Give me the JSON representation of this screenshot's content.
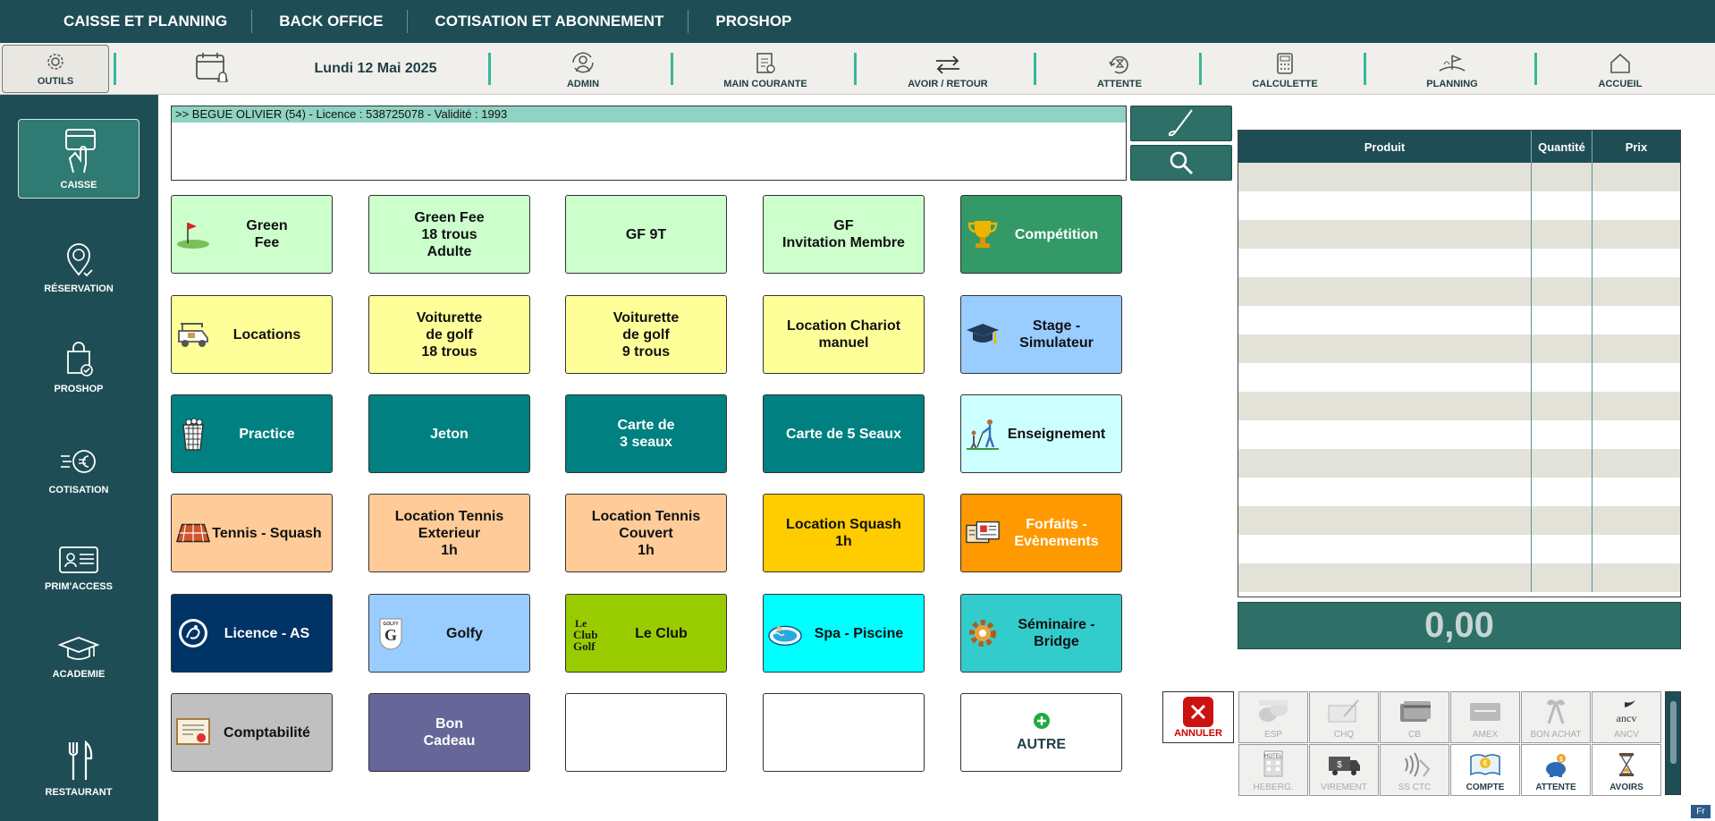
{
  "top_menu": [
    "CAISSE ET PLANNING",
    "BACK OFFICE",
    "COTISATION ET ABONNEMENT",
    "PROSHOP"
  ],
  "toolbar": {
    "outils": "OUTILS",
    "date": "Lundi 12 Mai 2025",
    "admin": "ADMIN",
    "main_courante": "MAIN COURANTE",
    "avoir_retour": "AVOIR / RETOUR",
    "attente": "ATTENTE",
    "calculette": "CALCULETTE",
    "planning": "PLANNING",
    "accueil": "ACCUEIL"
  },
  "sidebar": [
    "CAISSE",
    "RÉSERVATION",
    "PROSHOP",
    "COTISATION",
    "PRIM'ACCESS",
    "ACADEMIE",
    "RESTAURANT"
  ],
  "customer": {
    "line": ">> BEGUE OLIVIER (54) - Licence : 538725078 - Validité : 1993"
  },
  "products": [
    {
      "label": "Green\nFee",
      "bg": "#ccffcc",
      "fg": "#111111",
      "icon": "golf-flag-icon"
    },
    {
      "label": "Green Fee\n18 trous\nAdulte",
      "bg": "#ccffcc",
      "fg": "#111111",
      "icon": ""
    },
    {
      "label": "GF 9T",
      "bg": "#ccffcc",
      "fg": "#111111",
      "icon": ""
    },
    {
      "label": "GF\nInvitation Membre",
      "bg": "#ccffcc",
      "fg": "#111111",
      "icon": ""
    },
    {
      "label": "Compétition",
      "bg": "#339966",
      "fg": "#ffffff",
      "icon": "trophy-icon"
    },
    {
      "label": "Locations",
      "bg": "#ffff99",
      "fg": "#111111",
      "icon": "golf-cart-icon"
    },
    {
      "label": "Voiturette\nde golf\n18 trous",
      "bg": "#ffff99",
      "fg": "#111111",
      "icon": ""
    },
    {
      "label": "Voiturette\nde golf\n9 trous",
      "bg": "#ffff99",
      "fg": "#111111",
      "icon": ""
    },
    {
      "label": "Location Chariot\nmanuel",
      "bg": "#ffff99",
      "fg": "#111111",
      "icon": ""
    },
    {
      "label": "Stage -\nSimulateur",
      "bg": "#99ccff",
      "fg": "#111111",
      "icon": "graduation-cap-icon"
    },
    {
      "label": "Practice",
      "bg": "#008080",
      "fg": "#ffffff",
      "icon": "ball-bucket-icon"
    },
    {
      "label": "Jeton",
      "bg": "#008080",
      "fg": "#ffffff",
      "icon": ""
    },
    {
      "label": "Carte de\n3 seaux",
      "bg": "#008080",
      "fg": "#ffffff",
      "icon": ""
    },
    {
      "label": "Carte de 5 Seaux",
      "bg": "#008080",
      "fg": "#ffffff",
      "icon": ""
    },
    {
      "label": "Enseignement",
      "bg": "#ccffff",
      "fg": "#111111",
      "icon": "golf-lesson-icon"
    },
    {
      "label": "Tennis - Squash",
      "bg": "#ffcc99",
      "fg": "#111111",
      "icon": "tennis-court-icon"
    },
    {
      "label": "Location Tennis\nExterieur\n1h",
      "bg": "#ffcc99",
      "fg": "#111111",
      "icon": ""
    },
    {
      "label": "Location Tennis\nCouvert\n1h",
      "bg": "#ffcc99",
      "fg": "#111111",
      "icon": ""
    },
    {
      "label": "Location Squash\n1h",
      "bg": "#ffcc00",
      "fg": "#111111",
      "icon": ""
    },
    {
      "label": "Forfaits -\nEvènements",
      "bg": "#ff9900",
      "fg": "#ffffff",
      "icon": "tickets-icon"
    },
    {
      "label": "Licence - AS",
      "bg": "#003366",
      "fg": "#ffffff",
      "icon": "ffgolf-logo-icon"
    },
    {
      "label": "Golfy",
      "bg": "#99ccff",
      "fg": "#111111",
      "icon": "golfy-card-icon"
    },
    {
      "label": "Le Club",
      "bg": "#99cc00",
      "fg": "#111111",
      "icon": "le-club-golf-logo-icon"
    },
    {
      "label": "Spa - Piscine",
      "bg": "#00ffff",
      "fg": "#111111",
      "icon": "spa-pool-icon"
    },
    {
      "label": "Séminaire -\nBridge",
      "bg": "#33cccc",
      "fg": "#111111",
      "icon": "gear-icon"
    },
    {
      "label": "Comptabilité",
      "bg": "#c0c0c0",
      "fg": "#111111",
      "icon": "certificate-icon"
    },
    {
      "label": "Bon\nCadeau",
      "bg": "#666699",
      "fg": "#ffffff",
      "icon": ""
    },
    {
      "label": "",
      "bg": "#ffffff",
      "fg": "#111111",
      "icon": ""
    },
    {
      "label": "",
      "bg": "#ffffff",
      "fg": "#111111",
      "icon": ""
    },
    {
      "label": "AUTRE",
      "bg": "#ffffff",
      "fg": "#1f3e44",
      "icon": "plus-circle-icon"
    }
  ],
  "ticket": {
    "headers": [
      "Produit",
      "Quantité",
      "Prix"
    ],
    "total": "0,00"
  },
  "payment": {
    "annuler": "ANNULER",
    "methods": [
      {
        "label": "ESP",
        "active": false
      },
      {
        "label": "CHQ",
        "active": false
      },
      {
        "label": "CB",
        "active": false
      },
      {
        "label": "AMEX",
        "active": false
      },
      {
        "label": "BON ACHAT",
        "active": false
      },
      {
        "label": "ANCV",
        "active": false
      },
      {
        "label": "HEBERG.",
        "active": false
      },
      {
        "label": "VIREMENT",
        "active": false
      },
      {
        "label": "SS CTC",
        "active": false
      },
      {
        "label": "COMPTE",
        "active": true
      },
      {
        "label": "ATTENTE",
        "active": true
      },
      {
        "label": "AVOIRS",
        "active": true
      }
    ]
  },
  "language": "Fr"
}
